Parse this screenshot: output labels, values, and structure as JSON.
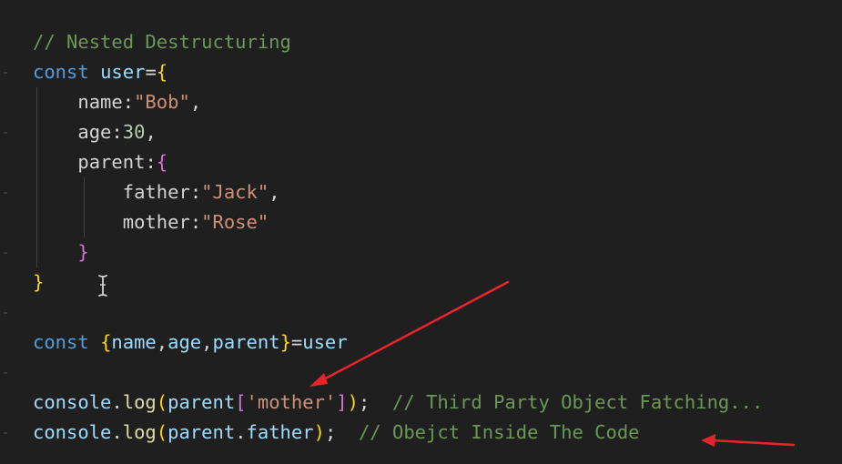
{
  "editor": {
    "lines": [
      {
        "tokens": [
          {
            "t": "// Nested Destructuring",
            "c": "c-comment"
          }
        ]
      },
      {
        "tokens": [
          {
            "t": "const",
            "c": "c-keyword"
          },
          {
            "t": " ",
            "c": "c-ident"
          },
          {
            "t": "user",
            "c": "c-var"
          },
          {
            "t": "=",
            "c": "c-punct"
          },
          {
            "t": "{",
            "c": "c-brace1"
          }
        ]
      },
      {
        "tokens": [
          {
            "t": "    ",
            "c": "c-ident"
          },
          {
            "t": "name",
            "c": "c-ident"
          },
          {
            "t": ":",
            "c": "c-punct"
          },
          {
            "t": "\"Bob\"",
            "c": "c-string"
          },
          {
            "t": ",",
            "c": "c-punct"
          }
        ]
      },
      {
        "tokens": [
          {
            "t": "    ",
            "c": "c-ident"
          },
          {
            "t": "age",
            "c": "c-ident"
          },
          {
            "t": ":",
            "c": "c-punct"
          },
          {
            "t": "30",
            "c": "c-number"
          },
          {
            "t": ",",
            "c": "c-punct"
          }
        ]
      },
      {
        "tokens": [
          {
            "t": "    ",
            "c": "c-ident"
          },
          {
            "t": "parent",
            "c": "c-ident"
          },
          {
            "t": ":",
            "c": "c-punct"
          },
          {
            "t": "{",
            "c": "c-brace2"
          }
        ]
      },
      {
        "tokens": [
          {
            "t": "        ",
            "c": "c-ident"
          },
          {
            "t": "father",
            "c": "c-ident"
          },
          {
            "t": ":",
            "c": "c-punct"
          },
          {
            "t": "\"Jack\"",
            "c": "c-string"
          },
          {
            "t": ",",
            "c": "c-punct"
          }
        ]
      },
      {
        "tokens": [
          {
            "t": "        ",
            "c": "c-ident"
          },
          {
            "t": "mother",
            "c": "c-ident"
          },
          {
            "t": ":",
            "c": "c-punct"
          },
          {
            "t": "\"Rose\"",
            "c": "c-string"
          }
        ]
      },
      {
        "tokens": [
          {
            "t": "    ",
            "c": "c-ident"
          },
          {
            "t": "}",
            "c": "c-brace2"
          }
        ]
      },
      {
        "tokens": [
          {
            "t": "}",
            "c": "c-brace1"
          }
        ]
      },
      {
        "tokens": []
      },
      {
        "tokens": [
          {
            "t": "const",
            "c": "c-keyword"
          },
          {
            "t": " ",
            "c": "c-ident"
          },
          {
            "t": "{",
            "c": "c-brace1"
          },
          {
            "t": "name",
            "c": "c-var"
          },
          {
            "t": ",",
            "c": "c-punct"
          },
          {
            "t": "age",
            "c": "c-var"
          },
          {
            "t": ",",
            "c": "c-punct"
          },
          {
            "t": "parent",
            "c": "c-var"
          },
          {
            "t": "}",
            "c": "c-brace1"
          },
          {
            "t": "=",
            "c": "c-punct"
          },
          {
            "t": "user",
            "c": "c-var"
          }
        ]
      },
      {
        "tokens": []
      },
      {
        "tokens": [
          {
            "t": "console",
            "c": "c-var"
          },
          {
            "t": ".",
            "c": "c-punct"
          },
          {
            "t": "log",
            "c": "c-func"
          },
          {
            "t": "(",
            "c": "c-brace1"
          },
          {
            "t": "parent",
            "c": "c-var"
          },
          {
            "t": "[",
            "c": "c-brace2"
          },
          {
            "t": "'mother'",
            "c": "c-string"
          },
          {
            "t": "]",
            "c": "c-brace2"
          },
          {
            "t": ")",
            "c": "c-brace1"
          },
          {
            "t": ";",
            "c": "c-punct"
          },
          {
            "t": "  ",
            "c": "c-ident"
          },
          {
            "t": "// Third Party Object Fatching...",
            "c": "c-comment"
          }
        ]
      },
      {
        "tokens": [
          {
            "t": "console",
            "c": "c-var"
          },
          {
            "t": ".",
            "c": "c-punct"
          },
          {
            "t": "log",
            "c": "c-func"
          },
          {
            "t": "(",
            "c": "c-brace1"
          },
          {
            "t": "parent",
            "c": "c-var"
          },
          {
            "t": ".",
            "c": "c-punct"
          },
          {
            "t": "father",
            "c": "c-var"
          },
          {
            "t": ")",
            "c": "c-brace1"
          },
          {
            "t": ";",
            "c": "c-punct"
          },
          {
            "t": "  ",
            "c": "c-ident"
          },
          {
            "t": "// Obejct Inside The Code",
            "c": "c-comment"
          }
        ]
      }
    ]
  },
  "icons": {
    "cursor": "text-cursor-icon",
    "arrow1": "red-arrow-icon",
    "arrow2": "red-arrow-icon"
  },
  "colors": {
    "background": "#1f1f1f",
    "comment": "#6a9955",
    "keyword": "#569cd6",
    "variable": "#9cdcfe",
    "string": "#ce9178",
    "number": "#b5cea8",
    "bracket_level1": "#ffd700",
    "bracket_level2": "#da70d6",
    "function": "#dcdcaa",
    "annotation_arrow": "#e8242a"
  }
}
